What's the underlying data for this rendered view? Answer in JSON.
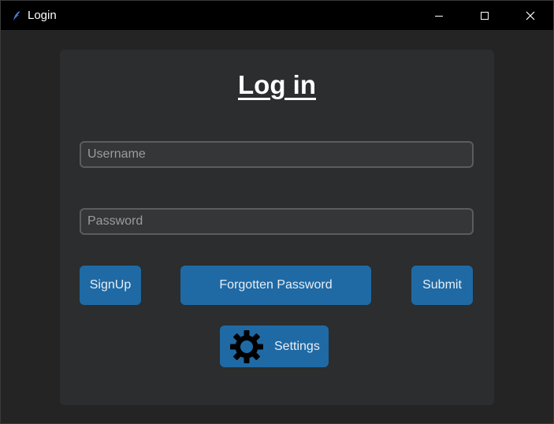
{
  "window": {
    "title": "Login",
    "controls": [
      "minimize-icon",
      "maximize-icon",
      "close-icon"
    ]
  },
  "form": {
    "heading": "Log in",
    "username_placeholder": "Username",
    "password_placeholder": "Password",
    "signup_label": "SignUp",
    "forgotten_label": "Forgotten Password",
    "submit_label": "Submit",
    "settings_label": "Settings",
    "settings_icon": "gear-icon"
  },
  "colors": {
    "background": "#242424",
    "card": "#2b2d2e",
    "button": "#1f6aa5",
    "input_bg": "#343638",
    "input_border": "#5a5d60"
  }
}
